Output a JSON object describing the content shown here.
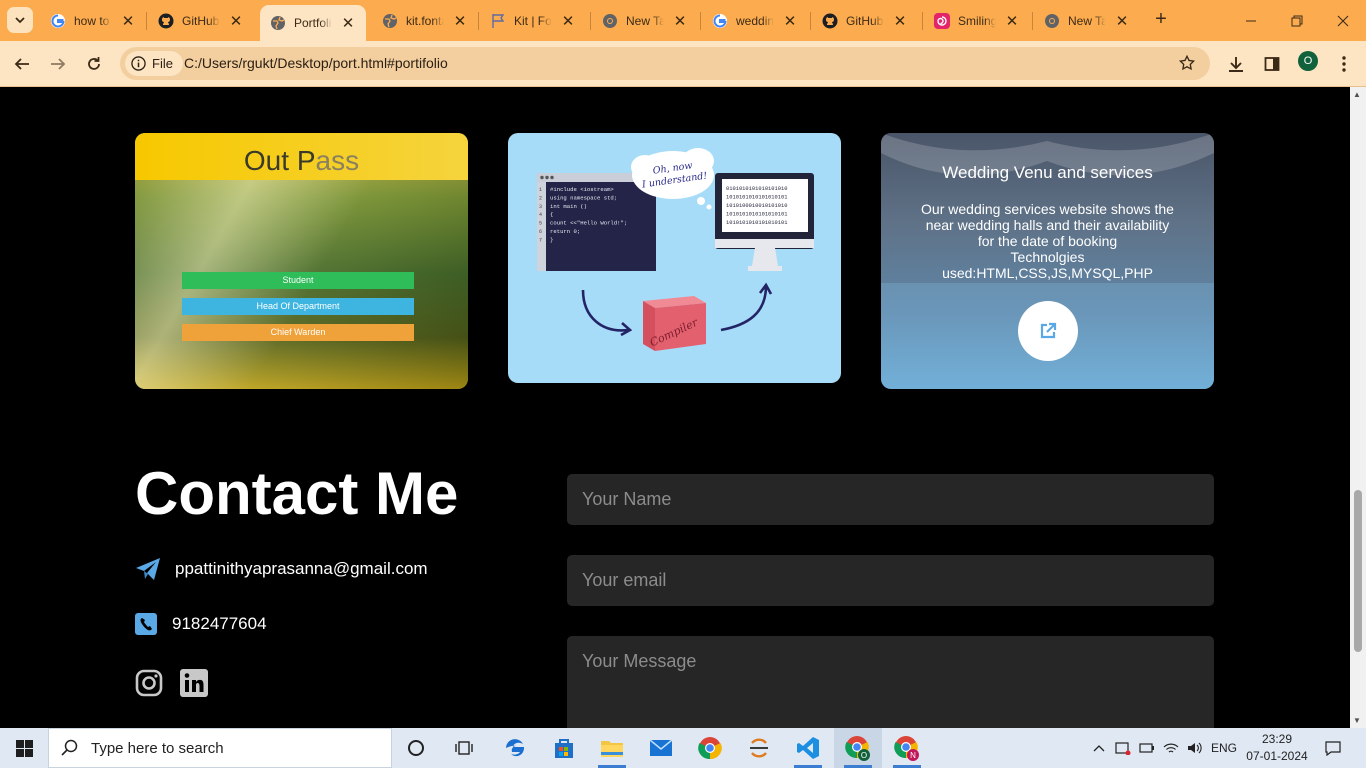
{
  "browser": {
    "tabs": [
      {
        "title": "how to",
        "icon": "google-icon"
      },
      {
        "title": "GitHub",
        "icon": "github-icon"
      },
      {
        "title": "Portfolio",
        "icon": "globe-icon",
        "active": true
      },
      {
        "title": "kit.fonta",
        "icon": "globe-icon"
      },
      {
        "title": "Kit | Font",
        "icon": "flag-icon"
      },
      {
        "title": "New Tab",
        "icon": "chrome-icon"
      },
      {
        "title": "wedding",
        "icon": "google-icon"
      },
      {
        "title": "GitHub",
        "icon": "github-icon"
      },
      {
        "title": "Smiling",
        "icon": "swirl-icon"
      },
      {
        "title": "New Tab",
        "icon": "chrome-icon"
      }
    ],
    "address": {
      "scheme_label": "File",
      "url": "C:/Users/rgukt/Desktop/port.html#portifolio"
    },
    "profile_initial": "O"
  },
  "portfolio": {
    "outpass": {
      "title_main": "Out P",
      "title_fade": "ass",
      "buttons": [
        {
          "label": "Student",
          "color": "#2ebd59"
        },
        {
          "label": "Head Of Department",
          "color": "#3db5e0"
        },
        {
          "label": "Chief Warden",
          "color": "#f0a23a"
        }
      ]
    },
    "compiler": {
      "bubble_text": [
        "Oh, now",
        "I understand!"
      ],
      "code_lines": [
        "#include <iostream>",
        "using namespace std;",
        "int main ()",
        "{",
        "  count <<\"Hello World!\";",
        "  return 0;",
        "}"
      ],
      "binary_lines": [
        "0101010101010101010",
        "1010101010101010101",
        "1010100010010101010",
        "1010101010101010101",
        "1010101010101010101"
      ],
      "box_label": "Compiler"
    },
    "wedding": {
      "title": "Wedding Venu and services",
      "description": "Our wedding services website shows the\nnear wedding halls and their availability\nfor the date of booking\nTechnolgies\nused:HTML,CSS,JS,MYSQL,PHP"
    }
  },
  "contact": {
    "heading": "Contact Me",
    "email": "ppattinithyaprasanna@gmail.com",
    "phone": "9182477604",
    "form": {
      "name_placeholder": "Your Name",
      "email_placeholder": "Your email",
      "message_placeholder": "Your Message"
    },
    "accent_color": "#5aa9e6"
  },
  "taskbar": {
    "search_placeholder": "Type here to search",
    "language": "ENG",
    "time": "23:29",
    "date": "07-01-2024"
  }
}
